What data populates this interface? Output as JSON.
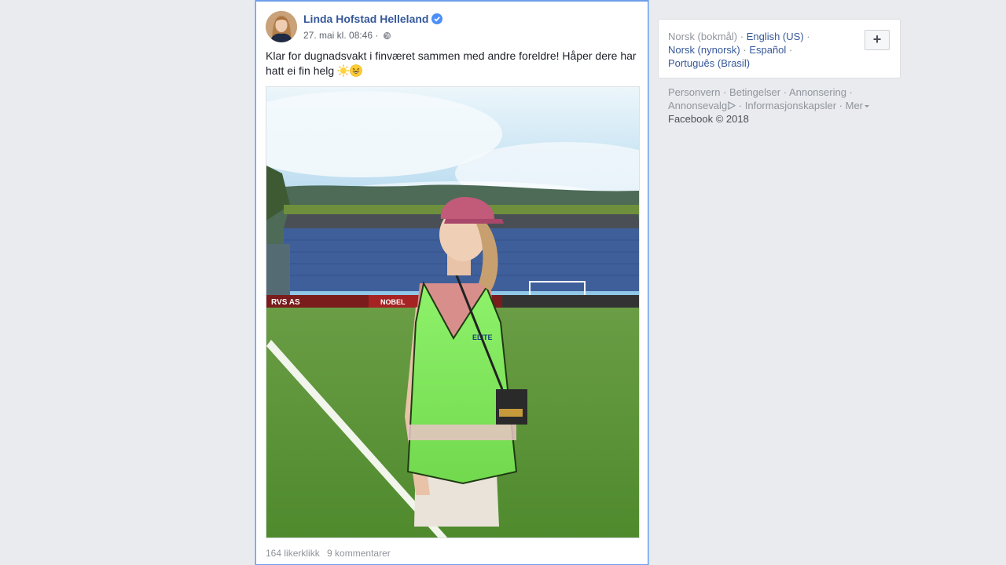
{
  "post": {
    "author": "Linda Hofstad Helleland",
    "timestamp": "27. mai kl. 08:46",
    "separator": " · ",
    "text": "Klar for dugnadsvakt i finværet sammen med andre foreldre! Håper dere har hatt ei fin helg",
    "emojis": [
      "sun-emoji",
      "grinning-emoji"
    ],
    "likes": "164 likerklikk",
    "comments": "9 kommentarer",
    "photo_banners": [
      "RVS AS",
      "NOBEL",
      "ELITE"
    ]
  },
  "sidebar": {
    "languages": {
      "current": "Norsk (bokmål)",
      "links": [
        "English (US)",
        "Norsk (nynorsk)",
        "Español",
        "Português (Brasil)"
      ],
      "add_button": "+"
    },
    "footer": {
      "links": [
        "Personvern",
        "Betingelser",
        "Annonsering",
        "Annonsevalg",
        "Informasjonskapsler",
        "Mer"
      ],
      "copyright": "Facebook © 2018"
    }
  },
  "colors": {
    "link": "#365899",
    "muted": "#90949c",
    "background": "#e9ebee",
    "focus_border": "#6d9eeb"
  }
}
